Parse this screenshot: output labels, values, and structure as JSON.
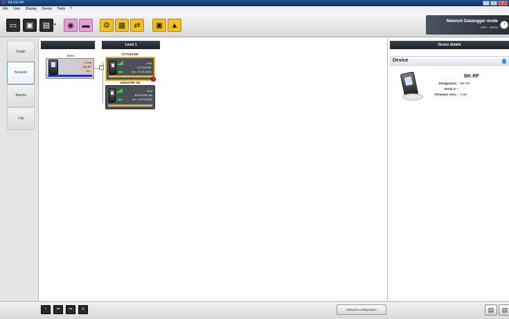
{
  "window": {
    "title": "KILOG RF",
    "buttons": [
      "–",
      "▢",
      "x"
    ]
  },
  "menu": [
    "File",
    "User",
    "Display",
    "Device",
    "Tools",
    "?"
  ],
  "toolbar": {
    "icons": [
      "new-file-icon",
      "save-icon",
      "print-preview-icon",
      "connect-icon",
      "print-icon",
      "settings-icon",
      "device-config-icon",
      "transfer-icon",
      "device-lock-icon",
      "alarm-icon"
    ],
    "icon_glyphs": [
      "▭",
      "▣",
      "▤",
      "◉",
      "▬",
      "⚙",
      "▦",
      "⇄",
      "▣",
      "▲"
    ],
    "arrow_glyph": "▾",
    "mode_title": "Network Datalogger mode",
    "mode_user": "User : admin",
    "mode_icon_glyph": "◔"
  },
  "sidebar": {
    "items": [
      {
        "label": "Graph",
        "active": false
      },
      {
        "label": "Network",
        "active": true
      },
      {
        "label": "Alarms",
        "active": false
      },
      {
        "label": "Log",
        "active": false
      }
    ]
  },
  "network": {
    "level_header": "Level 1",
    "base": {
      "title": "Base",
      "number": "n°238",
      "model": "BK-RF",
      "serial": "s/n :"
    },
    "collapse_glyph": "–",
    "sensors": [
      {
        "title": "KTT310-RF",
        "number": "n°55",
        "model": "KTT310-RF",
        "serial": "s/n : 01.01.0001",
        "alarm": true,
        "selected": true
      },
      {
        "title": "KH210-RF AN",
        "number": "n°54",
        "model": "KH210-RF AN",
        "serial": "s/n : 01.01.0002",
        "alarm": false,
        "selected": false
      }
    ]
  },
  "details": {
    "header": "Device details",
    "section": "Device",
    "name": "BK-RF",
    "fields": [
      {
        "label": "Designation :",
        "value": "BK-RF"
      },
      {
        "label": "Serial n° :",
        "value": ""
      },
      {
        "label": "Firmware vers. :",
        "value": "0.00"
      }
    ]
  },
  "bottom": {
    "view_buttons": [
      "view-single-icon",
      "view-double-icon",
      "view-quad-icon",
      "view-list-icon"
    ],
    "view_glyphs": [
      "▫",
      "▪▪",
      "▪▪",
      "≡"
    ],
    "network_config": "Network configuration",
    "right_glyphs": [
      "▤",
      "▤"
    ]
  }
}
